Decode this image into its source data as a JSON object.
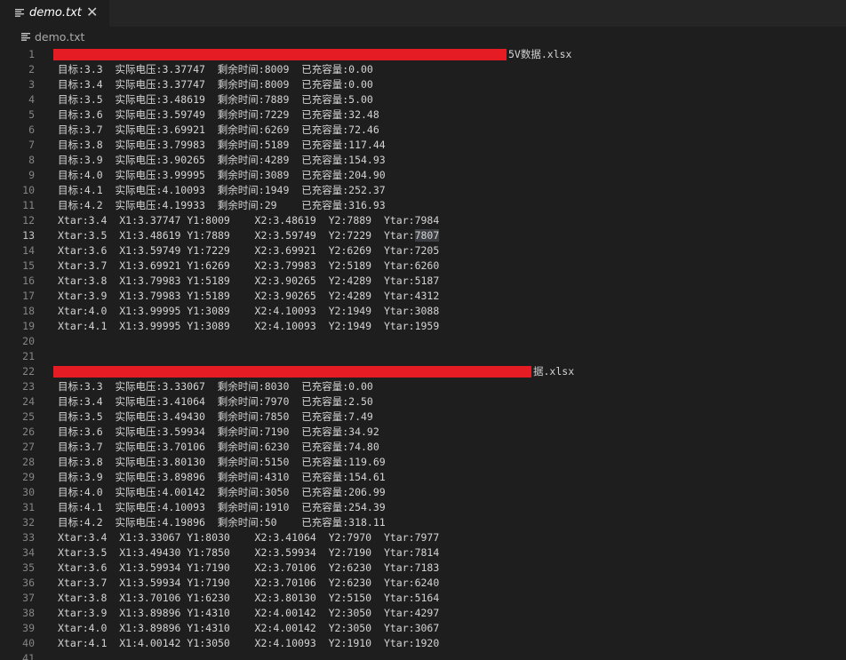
{
  "tab": {
    "label": "demo.txt",
    "close": "✕"
  },
  "breadcrumb": {
    "label": "demo.txt"
  },
  "colors": {
    "background": "#1e1e1e",
    "text": "#d4d4d4",
    "line_number": "#858585",
    "redaction": "#e51c24"
  },
  "lines": [
    {
      "n": "1",
      "pre": "",
      "post": "5V数据.xlsx",
      "redacted": true
    },
    {
      "n": "2",
      "text": "目标:3.3  实际电压:3.37747  剩余时间:8009  已充容量:0.00"
    },
    {
      "n": "3",
      "text": "目标:3.4  实际电压:3.37747  剩余时间:8009  已充容量:0.00"
    },
    {
      "n": "4",
      "text": "目标:3.5  实际电压:3.48619  剩余时间:7889  已充容量:5.00"
    },
    {
      "n": "5",
      "text": "目标:3.6  实际电压:3.59749  剩余时间:7229  已充容量:32.48"
    },
    {
      "n": "6",
      "text": "目标:3.7  实际电压:3.69921  剩余时间:6269  已充容量:72.46"
    },
    {
      "n": "7",
      "text": "目标:3.8  实际电压:3.79983  剩余时间:5189  已充容量:117.44"
    },
    {
      "n": "8",
      "text": "目标:3.9  实际电压:3.90265  剩余时间:4289  已充容量:154.93"
    },
    {
      "n": "9",
      "text": "目标:4.0  实际电压:3.99995  剩余时间:3089  已充容量:204.90"
    },
    {
      "n": "10",
      "text": "目标:4.1  实际电压:4.10093  剩余时间:1949  已充容量:252.37"
    },
    {
      "n": "11",
      "text": "目标:4.2  实际电压:4.19933  剩余时间:29    已充容量:316.93"
    },
    {
      "n": "12",
      "text": "Xtar:3.4  X1:3.37747 Y1:8009    X2:3.48619  Y2:7889  Ytar:7984"
    },
    {
      "n": "13",
      "pre": "Xtar:3.5  X1:3.48619 Y1:7889    X2:3.59749  Y2:7229  Ytar:",
      "hl": "7807",
      "active": true
    },
    {
      "n": "14",
      "text": "Xtar:3.6  X1:3.59749 Y1:7229    X2:3.69921  Y2:6269  Ytar:7205"
    },
    {
      "n": "15",
      "text": "Xtar:3.7  X1:3.69921 Y1:6269    X2:3.79983  Y2:5189  Ytar:6260"
    },
    {
      "n": "16",
      "text": "Xtar:3.8  X1:3.79983 Y1:5189    X2:3.90265  Y2:4289  Ytar:5187"
    },
    {
      "n": "17",
      "text": "Xtar:3.9  X1:3.79983 Y1:5189    X2:3.90265  Y2:4289  Ytar:4312"
    },
    {
      "n": "18",
      "text": "Xtar:4.0  X1:3.99995 Y1:3089    X2:4.10093  Y2:1949  Ytar:3088"
    },
    {
      "n": "19",
      "text": "Xtar:4.1  X1:3.99995 Y1:3089    X2:4.10093  Y2:1949  Ytar:1959"
    },
    {
      "n": "20",
      "text": ""
    },
    {
      "n": "21",
      "text": ""
    },
    {
      "n": "22",
      "pre": "",
      "post": "据.xlsx",
      "redacted": true
    },
    {
      "n": "23",
      "text": "目标:3.3  实际电压:3.33067  剩余时间:8030  已充容量:0.00"
    },
    {
      "n": "24",
      "text": "目标:3.4  实际电压:3.41064  剩余时间:7970  已充容量:2.50"
    },
    {
      "n": "25",
      "text": "目标:3.5  实际电压:3.49430  剩余时间:7850  已充容量:7.49"
    },
    {
      "n": "26",
      "text": "目标:3.6  实际电压:3.59934  剩余时间:7190  已充容量:34.92"
    },
    {
      "n": "27",
      "text": "目标:3.7  实际电压:3.70106  剩余时间:6230  已充容量:74.80"
    },
    {
      "n": "28",
      "text": "目标:3.8  实际电压:3.80130  剩余时间:5150  已充容量:119.69"
    },
    {
      "n": "29",
      "text": "目标:3.9  实际电压:3.89896  剩余时间:4310  已充容量:154.61"
    },
    {
      "n": "30",
      "text": "目标:4.0  实际电压:4.00142  剩余时间:3050  已充容量:206.99"
    },
    {
      "n": "31",
      "text": "目标:4.1  实际电压:4.10093  剩余时间:1910  已充容量:254.39"
    },
    {
      "n": "32",
      "text": "目标:4.2  实际电压:4.19896  剩余时间:50    已充容量:318.11"
    },
    {
      "n": "33",
      "text": "Xtar:3.4  X1:3.33067 Y1:8030    X2:3.41064  Y2:7970  Ytar:7977"
    },
    {
      "n": "34",
      "text": "Xtar:3.5  X1:3.49430 Y1:7850    X2:3.59934  Y2:7190  Ytar:7814"
    },
    {
      "n": "35",
      "text": "Xtar:3.6  X1:3.59934 Y1:7190    X2:3.70106  Y2:6230  Ytar:7183"
    },
    {
      "n": "36",
      "text": "Xtar:3.7  X1:3.59934 Y1:7190    X2:3.70106  Y2:6230  Ytar:6240"
    },
    {
      "n": "37",
      "text": "Xtar:3.8  X1:3.70106 Y1:6230    X2:3.80130  Y2:5150  Ytar:5164"
    },
    {
      "n": "38",
      "text": "Xtar:3.9  X1:3.89896 Y1:4310    X2:4.00142  Y2:3050  Ytar:4297"
    },
    {
      "n": "39",
      "text": "Xtar:4.0  X1:3.89896 Y1:4310    X2:4.00142  Y2:3050  Ytar:3067"
    },
    {
      "n": "40",
      "text": "Xtar:4.1  X1:4.00142 Y1:3050    X2:4.10093  Y2:1910  Ytar:1920"
    },
    {
      "n": "41",
      "text": ""
    }
  ]
}
